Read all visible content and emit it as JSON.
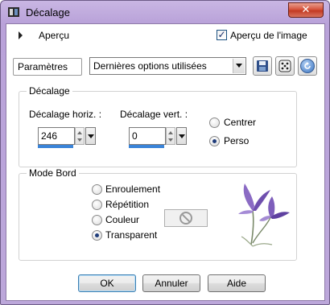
{
  "window": {
    "title": "Décalage",
    "close_glyph": "✕"
  },
  "preview": {
    "label": "Aperçu",
    "checkbox_checked": true,
    "checkbox_label": "Aperçu de l'image"
  },
  "params": {
    "label": "Paramètres",
    "selected": "Dernières options utilisées"
  },
  "offset_group": {
    "title": "Décalage",
    "horiz_label": "Décalage horiz. :",
    "horiz_value": "246",
    "vert_label": "Décalage vert. :",
    "vert_value": "0",
    "radios": [
      {
        "label": "Centrer",
        "selected": false
      },
      {
        "label": "Perso",
        "selected": true
      }
    ]
  },
  "edge_group": {
    "title": "Mode Bord",
    "radios": [
      {
        "label": "Enroulement",
        "selected": false
      },
      {
        "label": "Répétition",
        "selected": false
      },
      {
        "label": "Couleur",
        "selected": false
      },
      {
        "label": "Transparent",
        "selected": true
      }
    ]
  },
  "buttons": {
    "ok": "OK",
    "cancel": "Annuler",
    "help": "Aide"
  },
  "colors": {
    "title_gradient": "#c9b6e3",
    "close_red": "#c33a23",
    "spin_bar": "#3a84d8"
  }
}
